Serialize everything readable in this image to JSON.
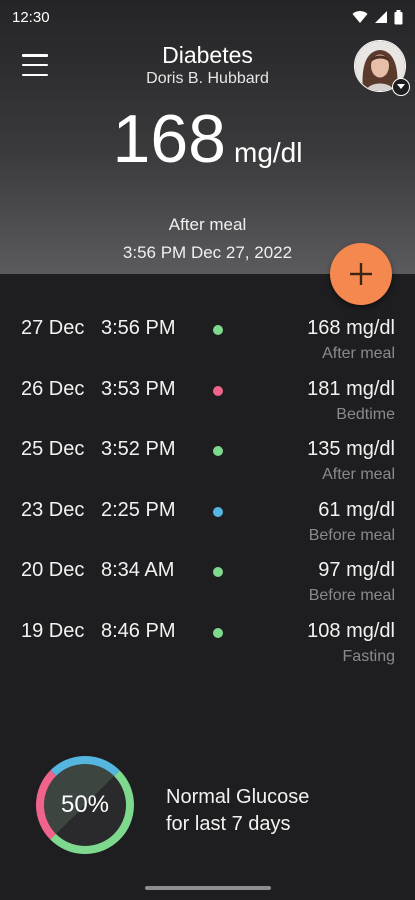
{
  "status_bar": {
    "time": "12:30",
    "icons": [
      "wifi-icon",
      "cellular-signal-icon",
      "battery-icon"
    ]
  },
  "header": {
    "title": "Diabetes",
    "subtitle": "Doris B. Hubbard",
    "menu_icon": "menu-icon",
    "avatar_badge_icon": "chevron-down-icon"
  },
  "latest_reading": {
    "value": "168",
    "unit": "mg/dl",
    "context": "After meal",
    "timestamp": "3:56 PM Dec 27, 2022"
  },
  "fab": {
    "icon": "plus-icon",
    "color": "#f5884e"
  },
  "status_colors": {
    "normal": "#7ed98e",
    "high": "#f0648c",
    "low": "#55b6e0"
  },
  "readings": [
    {
      "date": "27 Dec",
      "time": "3:56 PM",
      "value": "168 mg/dl",
      "context": "After meal",
      "status": "normal"
    },
    {
      "date": "26 Dec",
      "time": "3:53 PM",
      "value": "181 mg/dl",
      "context": "Bedtime",
      "status": "high"
    },
    {
      "date": "25 Dec",
      "time": "3:52 PM",
      "value": "135 mg/dl",
      "context": "After meal",
      "status": "normal"
    },
    {
      "date": "23 Dec",
      "time": "2:25 PM",
      "value": "61 mg/dl",
      "context": "Before meal",
      "status": "low"
    },
    {
      "date": "20 Dec",
      "time": "8:34 AM",
      "value": "97 mg/dl",
      "context": "Before meal",
      "status": "normal"
    },
    {
      "date": "19 Dec",
      "time": "8:46 PM",
      "value": "108 mg/dl",
      "context": "Fasting",
      "status": "normal"
    }
  ],
  "summary": {
    "percent_label": "50%",
    "normal_fraction": 0.5,
    "line1": "Normal Glucose",
    "line2": "for last 7 days",
    "ring_segments": [
      {
        "status": "normal",
        "fraction": 0.5
      },
      {
        "status": "high",
        "fraction": 0.25
      },
      {
        "status": "low",
        "fraction": 0.25
      }
    ]
  }
}
